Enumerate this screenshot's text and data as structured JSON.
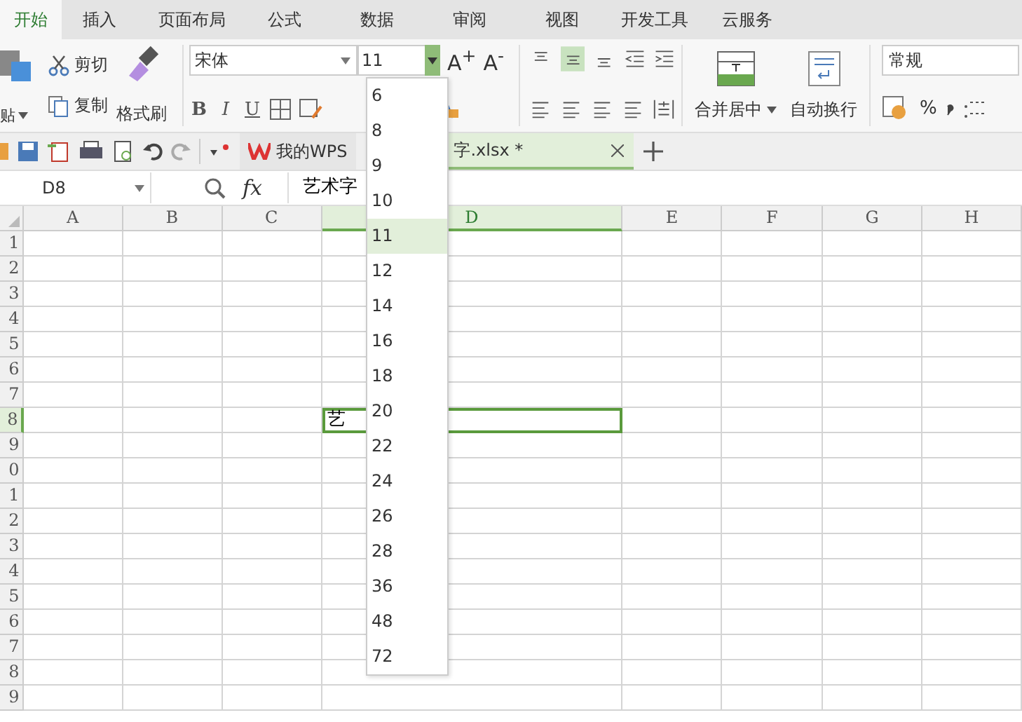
{
  "tabs": [
    {
      "label": "开始",
      "selected": true
    },
    {
      "label": "插入",
      "selected": false
    },
    {
      "label": "页面布局",
      "selected": false
    },
    {
      "label": "公式",
      "selected": false
    },
    {
      "label": "数据",
      "selected": false
    },
    {
      "label": "审阅",
      "selected": false
    },
    {
      "label": "视图",
      "selected": false
    },
    {
      "label": "开发工具",
      "selected": false
    },
    {
      "label": "云服务",
      "selected": false
    }
  ],
  "ribbon": {
    "clipboard": {
      "paste": "贴",
      "cut": "剪切",
      "copy": "复制",
      "format_painter": "格式刷"
    },
    "font": {
      "name": "宋体",
      "size": "11",
      "grow": "A$^{+}$",
      "shrink": "A$^{-}$",
      "styles": [
        "B",
        "I",
        "U"
      ]
    },
    "alignment": {
      "vertical": [
        {
          "selected": false
        },
        {
          "selected": true
        },
        {
          "selected": false
        }
      ],
      "merge_center": "合并居中",
      "wrap_text": "自动换行"
    },
    "number": {
      "format": "常规",
      "percent": "%"
    }
  },
  "quick_bar": {
    "my_wps": "我的WPS",
    "document_tab": "字.xlsx *"
  },
  "formula_bar": {
    "name_box": "D8",
    "fx": "fx",
    "content": "艺术字"
  },
  "sheet": {
    "columns": [
      {
        "label": "A",
        "selected": false
      },
      {
        "label": "B",
        "selected": false
      },
      {
        "label": "C",
        "selected": false
      },
      {
        "label": "D",
        "selected": true
      },
      {
        "label": "E",
        "selected": false
      },
      {
        "label": "F",
        "selected": false
      },
      {
        "label": "G",
        "selected": false
      },
      {
        "label": "H",
        "selected": false
      }
    ],
    "rows": [
      {
        "label": "1",
        "selected": false
      },
      {
        "label": "2",
        "selected": false
      },
      {
        "label": "3",
        "selected": false
      },
      {
        "label": "4",
        "selected": false
      },
      {
        "label": "5",
        "selected": false
      },
      {
        "label": "6",
        "selected": false
      },
      {
        "label": "7",
        "selected": false
      },
      {
        "label": "8",
        "selected": true
      },
      {
        "label": "9",
        "selected": false
      },
      {
        "label": "0",
        "selected": false
      },
      {
        "label": "1",
        "selected": false
      },
      {
        "label": "2",
        "selected": false
      },
      {
        "label": "3",
        "selected": false
      },
      {
        "label": "4",
        "selected": false
      },
      {
        "label": "5",
        "selected": false
      },
      {
        "label": "6",
        "selected": false
      },
      {
        "label": "7",
        "selected": false
      },
      {
        "label": "8",
        "selected": false
      },
      {
        "label": "9",
        "selected": false
      }
    ],
    "active_cell_text": "艺"
  },
  "font_size_menu": {
    "items": [
      {
        "label": "6",
        "selected": false
      },
      {
        "label": "8",
        "selected": false
      },
      {
        "label": "9",
        "selected": false
      },
      {
        "label": "10",
        "selected": false
      },
      {
        "label": "11",
        "selected": true
      },
      {
        "label": "12",
        "selected": false
      },
      {
        "label": "14",
        "selected": false
      },
      {
        "label": "16",
        "selected": false
      },
      {
        "label": "18",
        "selected": false
      },
      {
        "label": "20",
        "selected": false
      },
      {
        "label": "22",
        "selected": false
      },
      {
        "label": "24",
        "selected": false
      },
      {
        "label": "26",
        "selected": false
      },
      {
        "label": "28",
        "selected": false
      },
      {
        "label": "36",
        "selected": false
      },
      {
        "label": "48",
        "selected": false
      },
      {
        "label": "72",
        "selected": false
      }
    ]
  }
}
